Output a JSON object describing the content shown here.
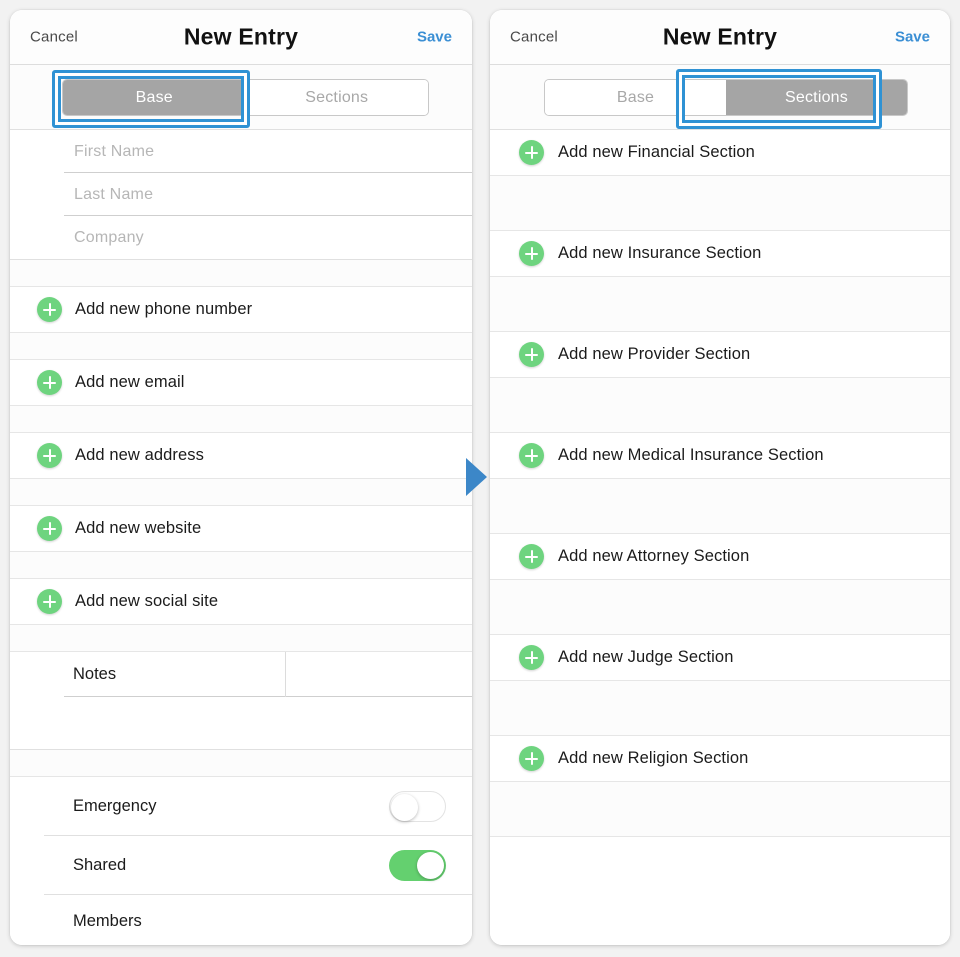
{
  "panels": {
    "left": {
      "nav": {
        "cancel": "Cancel",
        "title": "New Entry",
        "save": "Save"
      },
      "segmented": {
        "options": [
          "Base",
          "Sections"
        ],
        "selected": "Base",
        "highlighted": "Base"
      },
      "fields": [
        {
          "placeholder": "First Name",
          "value": ""
        },
        {
          "placeholder": "Last Name",
          "value": ""
        },
        {
          "placeholder": "Company",
          "value": ""
        }
      ],
      "add_items": [
        {
          "label": "Add new phone number",
          "icon": "plus-circle-icon"
        },
        {
          "label": "Add new email",
          "icon": "plus-circle-icon"
        },
        {
          "label": "Add new address",
          "icon": "plus-circle-icon"
        },
        {
          "label": "Add new website",
          "icon": "plus-circle-icon"
        },
        {
          "label": "Add new social site",
          "icon": "plus-circle-icon"
        }
      ],
      "notes": {
        "label": "Notes",
        "value": ""
      },
      "toggles": [
        {
          "label": "Emergency",
          "state": "off"
        },
        {
          "label": "Shared",
          "state": "on"
        }
      ],
      "members": {
        "label": "Members"
      }
    },
    "right": {
      "nav": {
        "cancel": "Cancel",
        "title": "New Entry",
        "save": "Save"
      },
      "segmented": {
        "options": [
          "Base",
          "Sections"
        ],
        "selected": "Sections",
        "highlighted": "Sections"
      },
      "sections": [
        {
          "label": "Add new Financial Section",
          "icon": "plus-circle-icon"
        },
        {
          "label": "Add new Insurance Section",
          "icon": "plus-circle-icon"
        },
        {
          "label": "Add new Provider Section",
          "icon": "plus-circle-icon"
        },
        {
          "label": "Add new Medical Insurance Section",
          "icon": "plus-circle-icon"
        },
        {
          "label": "Add new Attorney Section",
          "icon": "plus-circle-icon"
        },
        {
          "label": "Add new Judge Section",
          "icon": "plus-circle-icon"
        },
        {
          "label": "Add new Religion Section",
          "icon": "plus-circle-icon"
        }
      ]
    }
  },
  "annotations": {
    "step_arrow": {
      "icon": "right-arrow-icon",
      "color": "#3c87c8"
    },
    "highlight_color": "#2f92d4"
  },
  "colors": {
    "accent_blue": "#3b8fd4",
    "plus_green": "#6ed47f",
    "toggle_on_green": "#64d06f",
    "segment_selected_gray": "#a5a5a5",
    "page_background": "#f2f2f2"
  }
}
